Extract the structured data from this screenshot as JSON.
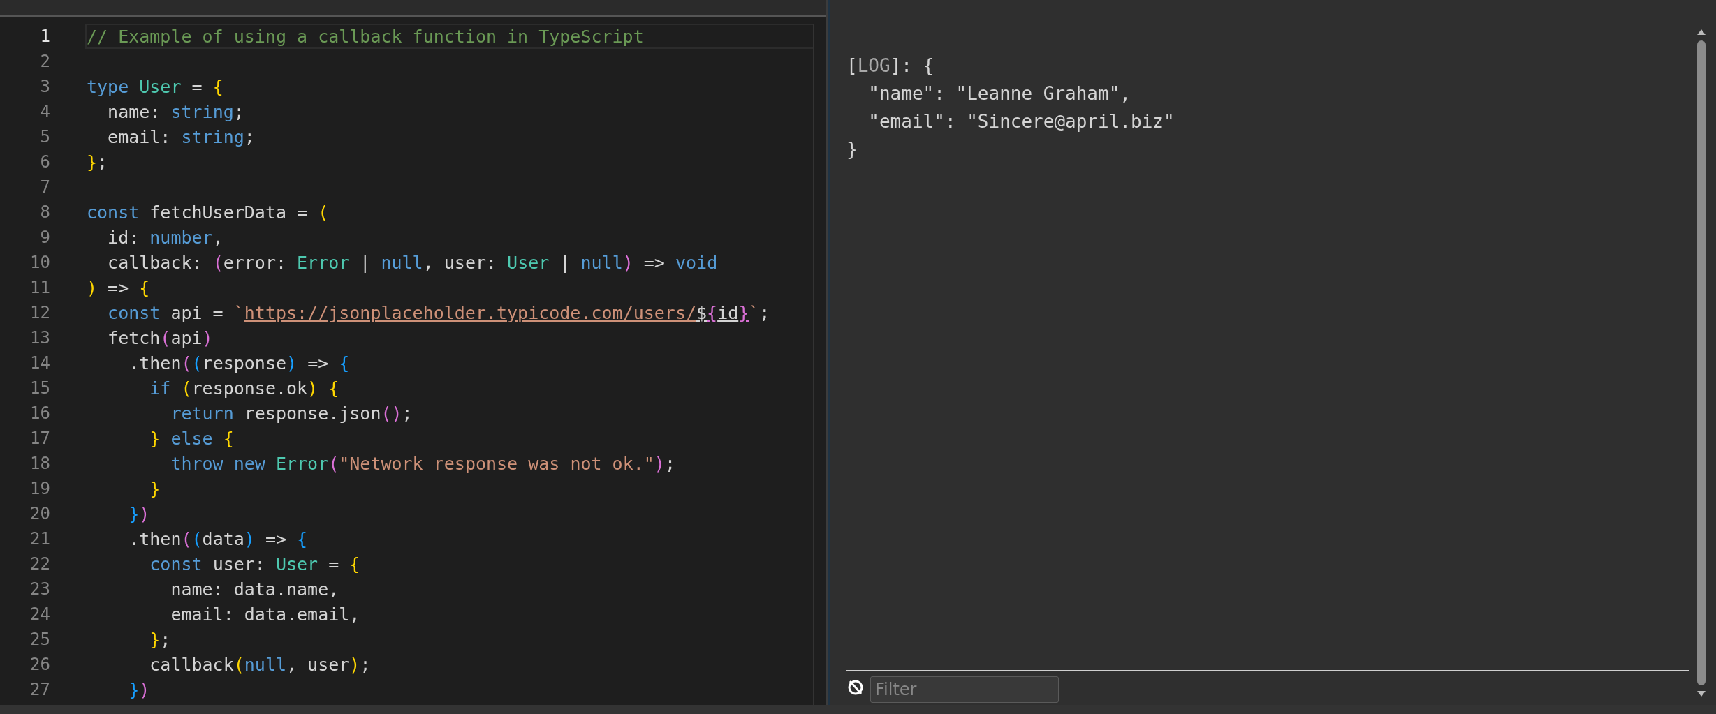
{
  "editor": {
    "lines": [
      {
        "number": "1",
        "current": true,
        "tokens": [
          {
            "kind": "comment",
            "text": "// Example of using a callback function in TypeScript"
          }
        ]
      },
      {
        "number": "2",
        "current": false
      },
      {
        "number": "3",
        "current": false,
        "tokens": [
          {
            "kind": "keyword",
            "text": "type "
          },
          {
            "kind": "type",
            "text": "User"
          },
          {
            "kind": "plain",
            "text": " = "
          },
          {
            "kind": "bracket1",
            "text": "{"
          }
        ]
      },
      {
        "number": "4",
        "current": false,
        "tokens": [
          {
            "kind": "plain",
            "text": "  name: "
          },
          {
            "kind": "keyword",
            "text": "string"
          },
          {
            "kind": "plain",
            "text": ";"
          }
        ]
      },
      {
        "number": "5",
        "current": false,
        "tokens": [
          {
            "kind": "plain",
            "text": "  email: "
          },
          {
            "kind": "keyword",
            "text": "string"
          },
          {
            "kind": "plain",
            "text": ";"
          }
        ]
      },
      {
        "number": "6",
        "current": false,
        "tokens": [
          {
            "kind": "bracket1",
            "text": "}"
          },
          {
            "kind": "plain",
            "text": ";"
          }
        ]
      },
      {
        "number": "7",
        "current": false
      },
      {
        "number": "8",
        "current": false,
        "tokens": [
          {
            "kind": "keyword",
            "text": "const"
          },
          {
            "kind": "plain",
            "text": " fetchUserData = "
          },
          {
            "kind": "bracket1",
            "text": "("
          }
        ]
      },
      {
        "number": "9",
        "current": false,
        "tokens": [
          {
            "kind": "plain",
            "text": "  id: "
          },
          {
            "kind": "keyword",
            "text": "number"
          },
          {
            "kind": "plain",
            "text": ","
          }
        ]
      },
      {
        "number": "10",
        "current": false,
        "tokens": [
          {
            "kind": "plain",
            "text": "  callback: "
          },
          {
            "kind": "bracket2",
            "text": "("
          },
          {
            "kind": "plain",
            "text": "error: "
          },
          {
            "kind": "type",
            "text": "Error"
          },
          {
            "kind": "plain",
            "text": " | "
          },
          {
            "kind": "keyword",
            "text": "null"
          },
          {
            "kind": "plain",
            "text": ", user: "
          },
          {
            "kind": "type",
            "text": "User"
          },
          {
            "kind": "plain",
            "text": " | "
          },
          {
            "kind": "keyword",
            "text": "null"
          },
          {
            "kind": "bracket2",
            "text": ")"
          },
          {
            "kind": "plain",
            "text": " => "
          },
          {
            "kind": "keyword",
            "text": "void"
          }
        ]
      },
      {
        "number": "11",
        "current": false,
        "tokens": [
          {
            "kind": "bracket1",
            "text": ")"
          },
          {
            "kind": "plain",
            "text": " => "
          },
          {
            "kind": "bracket1",
            "text": "{"
          }
        ]
      },
      {
        "number": "12",
        "current": false,
        "tokens": [
          {
            "kind": "keyword",
            "text": "  const"
          },
          {
            "kind": "plain",
            "text": " api = "
          },
          {
            "kind": "string",
            "text": "`"
          },
          {
            "kind": "url",
            "text": "https://jsonplaceholder.typicode.com/users/"
          },
          {
            "kind": "url-plain",
            "text": "$"
          },
          {
            "kind": "url-bracket",
            "text": "{"
          },
          {
            "kind": "url-plain",
            "text": "id"
          },
          {
            "kind": "url-bracket",
            "text": "}"
          },
          {
            "kind": "string",
            "text": "`"
          },
          {
            "kind": "plain",
            "text": ";"
          }
        ]
      },
      {
        "number": "13",
        "current": false,
        "tokens": [
          {
            "kind": "plain",
            "text": "  fetch"
          },
          {
            "kind": "bracket2",
            "text": "("
          },
          {
            "kind": "plain",
            "text": "api"
          },
          {
            "kind": "bracket2",
            "text": ")"
          }
        ]
      },
      {
        "number": "14",
        "current": false,
        "tokens": [
          {
            "kind": "plain",
            "text": "    .then"
          },
          {
            "kind": "bracket2",
            "text": "("
          },
          {
            "kind": "bracket3",
            "text": "("
          },
          {
            "kind": "plain",
            "text": "response"
          },
          {
            "kind": "bracket3",
            "text": ")"
          },
          {
            "kind": "plain",
            "text": " => "
          },
          {
            "kind": "bracket3",
            "text": "{"
          }
        ]
      },
      {
        "number": "15",
        "current": false,
        "tokens": [
          {
            "kind": "keyword",
            "text": "      if "
          },
          {
            "kind": "bracket1",
            "text": "("
          },
          {
            "kind": "plain",
            "text": "response.ok"
          },
          {
            "kind": "bracket1",
            "text": ") {"
          }
        ]
      },
      {
        "number": "16",
        "current": false,
        "tokens": [
          {
            "kind": "keyword",
            "text": "        return"
          },
          {
            "kind": "plain",
            "text": " response.json"
          },
          {
            "kind": "bracket2",
            "text": "()"
          },
          {
            "kind": "plain",
            "text": ";"
          }
        ]
      },
      {
        "number": "17",
        "current": false,
        "tokens": [
          {
            "kind": "bracket1",
            "text": "      } "
          },
          {
            "kind": "keyword",
            "text": "else "
          },
          {
            "kind": "bracket1",
            "text": "{"
          }
        ]
      },
      {
        "number": "18",
        "current": false,
        "tokens": [
          {
            "kind": "keyword",
            "text": "        throw new "
          },
          {
            "kind": "type",
            "text": "Error"
          },
          {
            "kind": "bracket2",
            "text": "("
          },
          {
            "kind": "string",
            "text": "\"Network response was not ok.\""
          },
          {
            "kind": "bracket2",
            "text": ")"
          },
          {
            "kind": "plain",
            "text": ";"
          }
        ]
      },
      {
        "number": "19",
        "current": false,
        "tokens": [
          {
            "kind": "bracket1",
            "text": "      }"
          }
        ]
      },
      {
        "number": "20",
        "current": false,
        "tokens": [
          {
            "kind": "bracket3",
            "text": "    }"
          },
          {
            "kind": "bracket2",
            "text": ")"
          }
        ]
      },
      {
        "number": "21",
        "current": false,
        "tokens": [
          {
            "kind": "plain",
            "text": "    .then"
          },
          {
            "kind": "bracket2",
            "text": "("
          },
          {
            "kind": "bracket3",
            "text": "("
          },
          {
            "kind": "plain",
            "text": "data"
          },
          {
            "kind": "bracket3",
            "text": ")"
          },
          {
            "kind": "plain",
            "text": " => "
          },
          {
            "kind": "bracket3",
            "text": "{"
          }
        ]
      },
      {
        "number": "22",
        "current": false,
        "tokens": [
          {
            "kind": "keyword",
            "text": "      const"
          },
          {
            "kind": "plain",
            "text": " user: "
          },
          {
            "kind": "type",
            "text": "User"
          },
          {
            "kind": "plain",
            "text": " = "
          },
          {
            "kind": "bracket1",
            "text": "{"
          }
        ]
      },
      {
        "number": "23",
        "current": false,
        "tokens": [
          {
            "kind": "plain",
            "text": "        name: data.name,"
          }
        ]
      },
      {
        "number": "24",
        "current": false,
        "tokens": [
          {
            "kind": "plain",
            "text": "        email: data.email,"
          }
        ]
      },
      {
        "number": "25",
        "current": false,
        "tokens": [
          {
            "kind": "bracket1",
            "text": "      }"
          },
          {
            "kind": "plain",
            "text": ";"
          }
        ]
      },
      {
        "number": "26",
        "current": false,
        "tokens": [
          {
            "kind": "plain",
            "text": "      callback"
          },
          {
            "kind": "bracket1",
            "text": "("
          },
          {
            "kind": "keyword",
            "text": "null"
          },
          {
            "kind": "plain",
            "text": ", user"
          },
          {
            "kind": "bracket1",
            "text": ")"
          },
          {
            "kind": "plain",
            "text": ";"
          }
        ]
      },
      {
        "number": "27",
        "current": false,
        "tokens": [
          {
            "kind": "bracket3",
            "text": "    }"
          },
          {
            "kind": "bracket2",
            "text": ")"
          }
        ]
      }
    ]
  },
  "console": {
    "lines": [
      [
        {
          "kind": "plain",
          "text": "["
        },
        {
          "kind": "dim",
          "text": "LOG"
        },
        {
          "kind": "plain",
          "text": "]: {"
        }
      ],
      [
        {
          "kind": "plain",
          "text": "  \"name\": \"Leanne Graham\","
        }
      ],
      [
        {
          "kind": "plain",
          "text": "  \"email\": \"Sincere@april.biz\""
        }
      ],
      [
        {
          "kind": "plain",
          "text": "}"
        }
      ]
    ],
    "filter": {
      "placeholder": "Filter"
    }
  }
}
